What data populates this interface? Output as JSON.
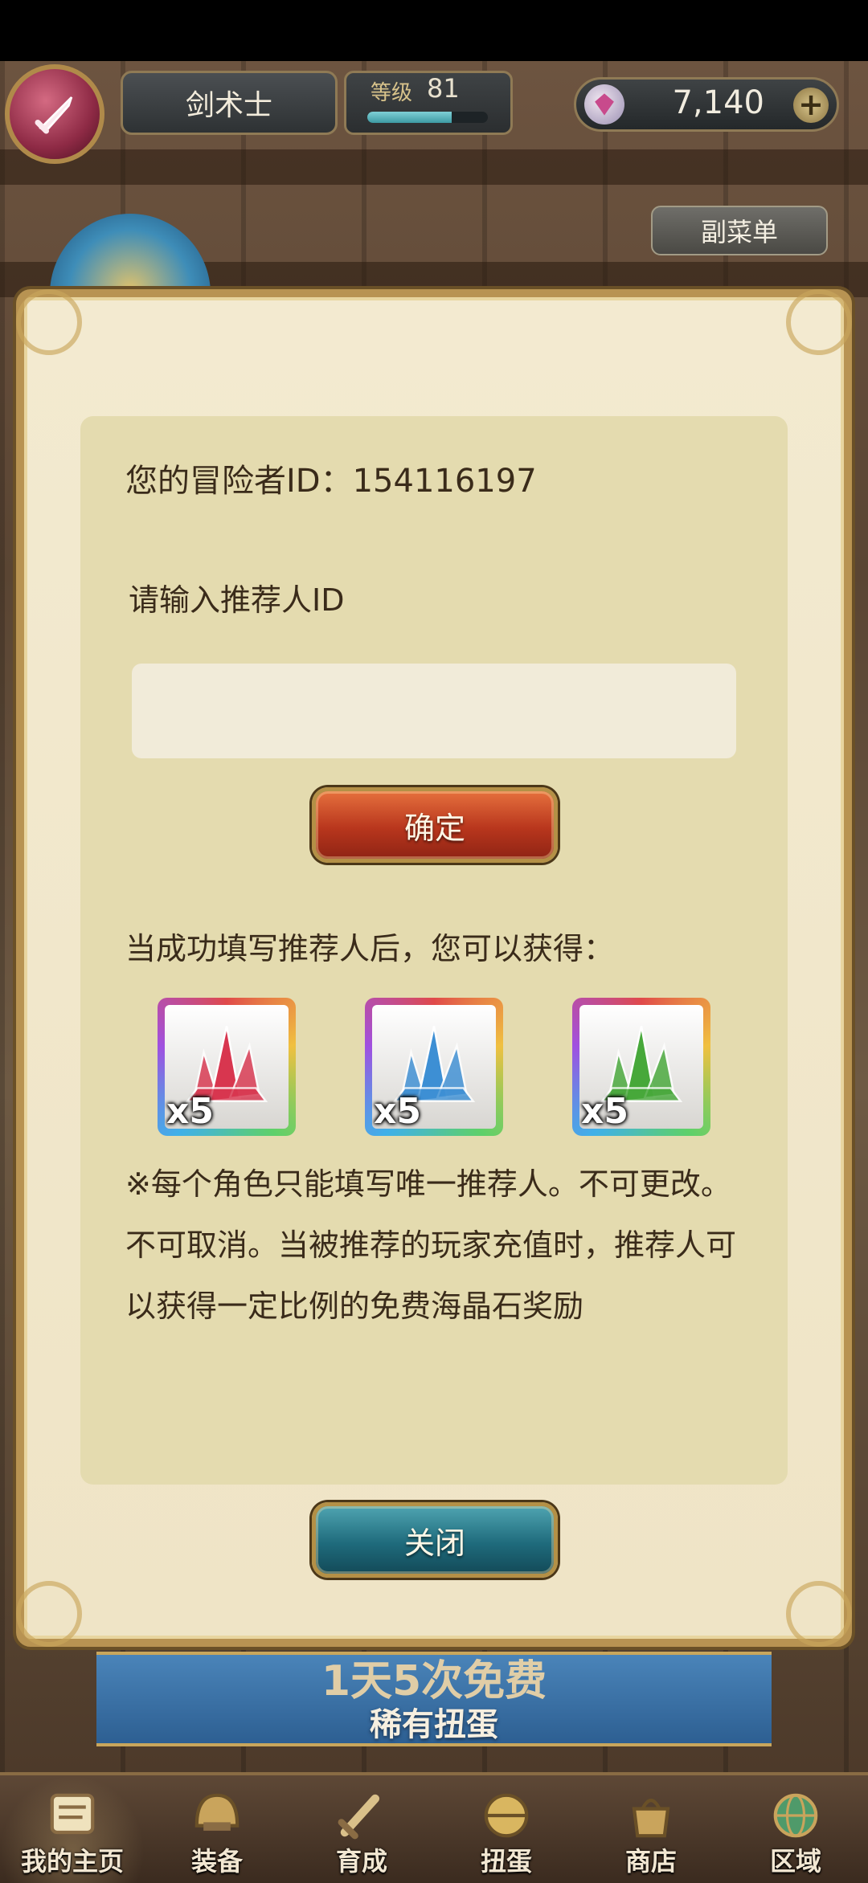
{
  "header": {
    "class_name": "剑术士",
    "level_label": "等级",
    "level_value": "81",
    "level_progress": 0.7,
    "gem_count": "7,140",
    "gem_plus": "+"
  },
  "submenu_label": "副菜单",
  "dialog": {
    "adventurer_id_line": "您的冒险者ID：154116197",
    "prompt": "请输入推荐人ID",
    "input_value": "",
    "input_placeholder": "",
    "confirm_label": "确定",
    "reward_line": "当成功填写推荐人后，您可以获得：",
    "rewards": [
      {
        "icon": "red-crystal-icon",
        "color": "#d8364f",
        "qty": "x5"
      },
      {
        "icon": "blue-crystal-icon",
        "color": "#3d8fd4",
        "qty": "x5"
      },
      {
        "icon": "green-crystal-icon",
        "color": "#47a83a",
        "qty": "x5"
      }
    ],
    "note": "※每个角色只能填写唯一推荐人。不可更改。不可取消。当被推荐的玩家充值时，推荐人可以获得一定比例的免费海晶石奖励",
    "close_label": "关闭"
  },
  "banner": {
    "title": "1天5次免费",
    "subtitle": "稀有扭蛋"
  },
  "nav": {
    "items": [
      {
        "label": "我的主页",
        "icon": "scroll-icon"
      },
      {
        "label": "装备",
        "icon": "helmet-icon"
      },
      {
        "label": "育成",
        "icon": "sword-icon"
      },
      {
        "label": "扭蛋",
        "icon": "capsule-icon"
      },
      {
        "label": "商店",
        "icon": "bag-icon"
      },
      {
        "label": "区域",
        "icon": "globe-icon"
      }
    ]
  }
}
